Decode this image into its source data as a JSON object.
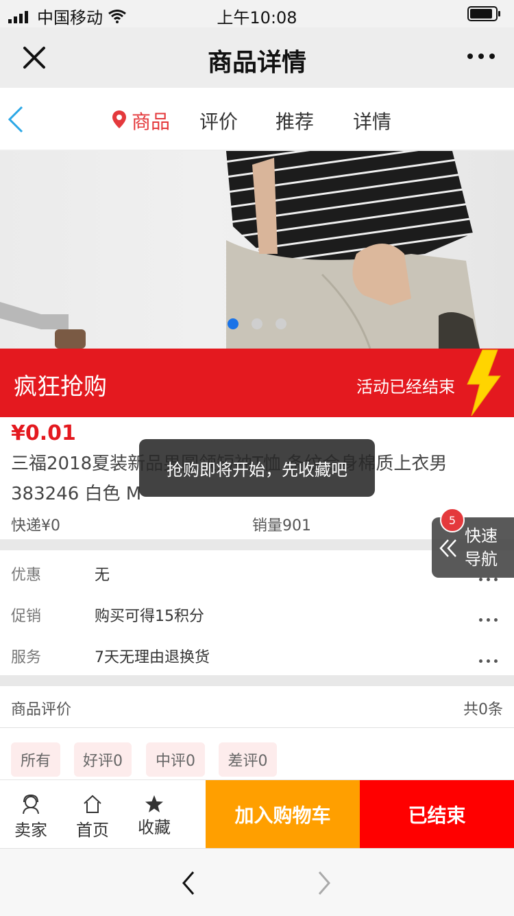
{
  "status_bar": {
    "carrier": "中国移动",
    "time": "上午10:08"
  },
  "nav": {
    "title": "商品详情"
  },
  "tabs": [
    {
      "label": "商品",
      "active": true
    },
    {
      "label": "评价",
      "active": false
    },
    {
      "label": "推荐",
      "active": false
    },
    {
      "label": "详情",
      "active": false
    }
  ],
  "promo": {
    "title": "疯狂抢购",
    "status": "活动已经结束"
  },
  "product": {
    "price": "¥0.01",
    "title": "三福2018夏装新品男圆领短袖T恤 条纹合身棉质上衣男 383246 白色 M",
    "shipping": "快递¥0",
    "sales": "销量901"
  },
  "info_rows": [
    {
      "label": "优惠",
      "value": "无"
    },
    {
      "label": "促销",
      "value": "购买可得15积分"
    },
    {
      "label": "服务",
      "value": "7天无理由退换货"
    }
  ],
  "reviews": {
    "title": "商品评价",
    "count": "共0条",
    "filters": [
      "所有",
      "好评0",
      "中评0",
      "差评0"
    ]
  },
  "action_bar": {
    "seller": "卖家",
    "home": "首页",
    "favorite": "收藏",
    "add_to_cart": "加入购物车",
    "ended": "已结束"
  },
  "toast": "抢购即将开始，先收藏吧",
  "quick_nav": {
    "line1": "快速",
    "line2": "导航",
    "badge": "5"
  },
  "colors": {
    "accent_red": "#e4191f",
    "cart_orange": "#ff9f00",
    "end_red": "#ff0000",
    "dot_active": "#1a73e8"
  }
}
